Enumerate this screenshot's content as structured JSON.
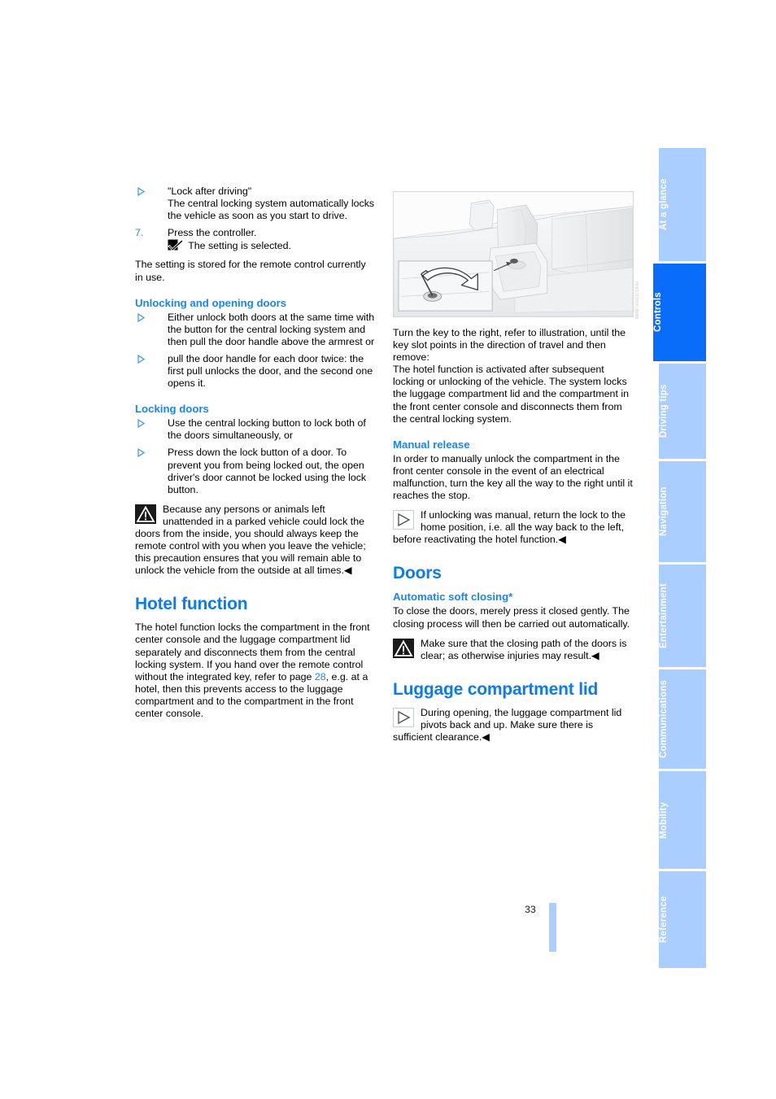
{
  "document": {
    "page_number": "33",
    "figure_id": "BMW-0000271A00"
  },
  "sidebar": {
    "tabs": [
      {
        "label": "At a glance",
        "active": false
      },
      {
        "label": "Controls",
        "active": true
      },
      {
        "label": "Driving tips",
        "active": false
      },
      {
        "label": "Navigation",
        "active": false
      },
      {
        "label": "Entertainment",
        "active": false
      },
      {
        "label": "Communications",
        "active": false
      },
      {
        "label": "Mobility",
        "active": false
      },
      {
        "label": "Reference",
        "active": false
      }
    ],
    "colors": {
      "inactive_bg": "#a9ceff",
      "active_bg": "#0a6dfa",
      "label": "#ffffff"
    }
  },
  "left_column": {
    "bullet_lock_after_driving": {
      "line1": "\"Lock after driving\"",
      "line2": "The central locking system automatically locks the vehicle as soon as you start to drive."
    },
    "step7": {
      "number": "7.",
      "text": "Press the controller.",
      "result": "The setting is selected."
    },
    "stored_note": "The setting is stored for the remote control currently in use.",
    "heading_unlocking": "Unlocking and opening doors",
    "unlocking_bullets": [
      "Either unlock both doors at the same time with the button for the central locking system and then pull the door handle above the armrest or",
      "pull the door handle for each door twice: the first pull unlocks the door, and the second one opens it."
    ],
    "heading_locking": "Locking doors",
    "locking_bullets": [
      "Use the central locking button to lock both of the doors simultaneously, or",
      "Press down the lock button of a door. To prevent you from being locked out, the open driver's door cannot be locked using the lock button."
    ],
    "warning_locking": "Because any persons or animals left unattended in a parked vehicle could lock the doors from the inside, you should always keep the remote control with you when you leave the vehicle; this precaution ensures that you will remain able to unlock the vehicle from the outside at all times.",
    "heading_hotel": "Hotel function",
    "hotel_paragraph_a": "The hotel function locks the compartment in the front center console and the luggage compartment lid separately and disconnects them from the central locking system. If you hand over the remote control without the integrated key, refer to page ",
    "hotel_page_link": "28",
    "hotel_paragraph_b": ", e.g. at a hotel, then this prevents access to the luggage compartment and to the compartment in the front center console."
  },
  "right_column": {
    "figure_caption_alt": "Center console key slot with inset detail of key being turned",
    "turn_key_paragraph": "Turn the key to the right, refer to illustration, until the key slot points in the direction of travel and then remove:",
    "hotel_activation_paragraph": "The hotel function is activated after subsequent locking or unlocking of the vehicle. The system locks the luggage compartment lid and the compartment in the front center console and disconnects them from the central locking system.",
    "heading_manual_release": "Manual release",
    "manual_release_paragraph": "In order to manually unlock the compartment in the front center console in the event of an electrical malfunction, turn the key all the way to the right until it reaches the stop.",
    "manual_release_note": "If unlocking was manual, return the lock to the home position, i.e. all the way back to the left, before reactivating the hotel function.",
    "heading_doors": "Doors",
    "heading_soft_closing": "Automatic soft closing*",
    "soft_closing_paragraph": "To close the doors, merely press it closed gently. The closing process will then be carried out automatically.",
    "soft_closing_warning": "Make sure that the closing path of the doors is clear; as otherwise injuries may result.",
    "heading_luggage": "Luggage compartment lid",
    "luggage_note": "During opening, the luggage compartment lid pivots back and up. Make sure there is sufficient clearance."
  },
  "symbols": {
    "end_mark": "◀",
    "bullet_triangle": "triangle-right-icon",
    "warning": "warning-triangle-icon",
    "note": "note-play-icon",
    "checkbox": "checkbox-checked-icon"
  },
  "colors": {
    "heading_blue": "#0a7bf0",
    "subheading_blue": "#1a84f5",
    "link_blue": "#1a84f5",
    "bullet_blue": "#3b94f2",
    "text": "#000000"
  }
}
